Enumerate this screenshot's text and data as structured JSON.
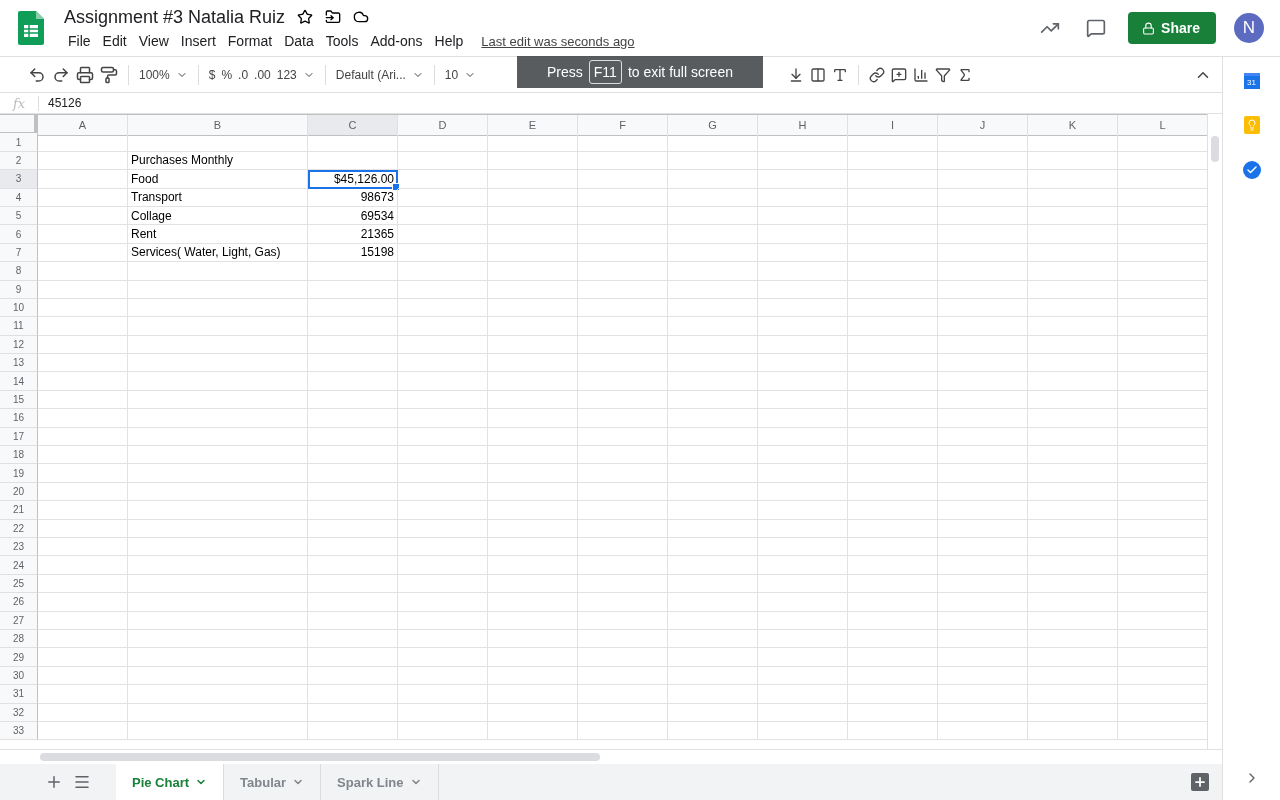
{
  "document": {
    "title": "Assignment #3 Natalia Ruiz",
    "last_edit": "Last edit was seconds ago"
  },
  "menu": [
    "File",
    "Edit",
    "View",
    "Insert",
    "Format",
    "Data",
    "Tools",
    "Add-ons",
    "Help"
  ],
  "share_button": "Share",
  "avatar": "N",
  "toolbar": {
    "zoom": "100%",
    "currency": "$",
    "percent": "%",
    "decrease_decimals": ".0",
    "increase_decimals": ".00",
    "more_formats": "123",
    "font": "Default (Ari...",
    "font_size": "10"
  },
  "fullscreen_notice": {
    "before": "Press",
    "key": "F11",
    "after": "to exit full screen"
  },
  "formula_bar": {
    "label": "fx",
    "value": "45126"
  },
  "columns": [
    {
      "label": "A",
      "selected": false
    },
    {
      "label": "B",
      "selected": false
    },
    {
      "label": "C",
      "selected": true
    },
    {
      "label": "D",
      "selected": false
    },
    {
      "label": "E",
      "selected": false
    },
    {
      "label": "F",
      "selected": false
    },
    {
      "label": "G",
      "selected": false
    },
    {
      "label": "H",
      "selected": false
    },
    {
      "label": "I",
      "selected": false
    },
    {
      "label": "J",
      "selected": false
    },
    {
      "label": "K",
      "selected": false
    },
    {
      "label": "L",
      "selected": false
    }
  ],
  "rows": [
    {
      "number": "1"
    },
    {
      "number": "2",
      "column_b": "Purchases Monthly"
    },
    {
      "number": "3",
      "column_b": "Food",
      "column_c": {
        "text": "$45,126.00",
        "selected": true
      }
    },
    {
      "number": "4",
      "column_b": "Transport",
      "column_c": {
        "text": "98673",
        "selected": false
      }
    },
    {
      "number": "5",
      "column_b": "Collage",
      "column_c": {
        "text": "69534",
        "selected": false
      }
    },
    {
      "number": "6",
      "column_b": "Rent",
      "column_c": {
        "text": "21365",
        "selected": false
      }
    },
    {
      "number": "7",
      "column_b": "Services( Water, Light, Gas)",
      "column_c": {
        "text": "15198",
        "selected": false
      }
    },
    {
      "number": "8"
    },
    {
      "number": "9"
    },
    {
      "number": "10"
    },
    {
      "number": "11"
    },
    {
      "number": "12"
    },
    {
      "number": "13"
    },
    {
      "number": "14"
    },
    {
      "number": "15"
    },
    {
      "number": "16"
    },
    {
      "number": "17"
    },
    {
      "number": "18"
    },
    {
      "number": "19"
    },
    {
      "number": "20"
    },
    {
      "number": "21"
    },
    {
      "number": "22"
    },
    {
      "number": "23"
    },
    {
      "number": "24"
    },
    {
      "number": "25"
    },
    {
      "number": "26"
    },
    {
      "number": "27"
    },
    {
      "number": "28"
    },
    {
      "number": "29"
    },
    {
      "number": "30"
    },
    {
      "number": "31"
    },
    {
      "number": "32"
    },
    {
      "number": "33"
    }
  ],
  "sheet_tabs": [
    {
      "label": "Pie Chart",
      "selected": true
    },
    {
      "label": "Tabular",
      "selected": false
    },
    {
      "label": "Spark Line",
      "selected": false
    }
  ],
  "side_panel": {
    "calendar_day": "31"
  }
}
